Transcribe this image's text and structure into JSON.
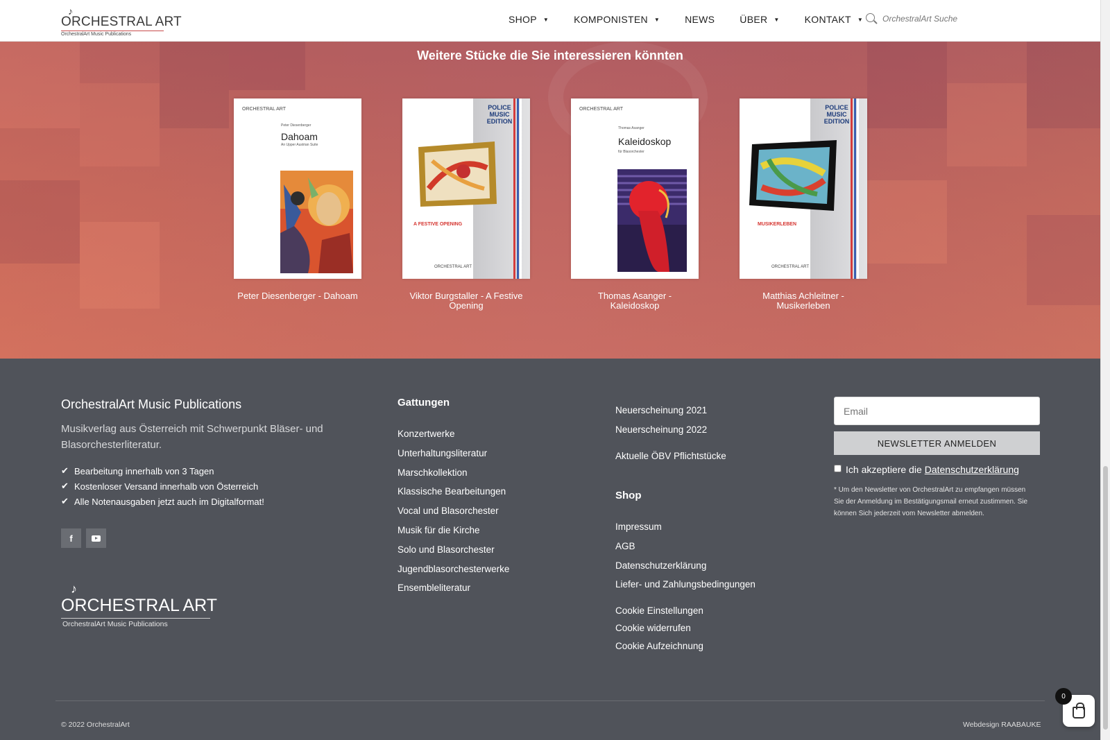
{
  "header": {
    "logo": {
      "name": "ORCHESTRAL ART",
      "sub": "OrchestralArt Music Publications"
    },
    "nav": [
      {
        "label": "SHOP",
        "caret": "▼"
      },
      {
        "label": "KOMPONISTEN",
        "caret": "▼"
      },
      {
        "label": "NEWS",
        "caret": ""
      },
      {
        "label": "ÜBER",
        "caret": "▼"
      },
      {
        "label": "KONTAKT",
        "caret": "▼"
      }
    ],
    "search": {
      "placeholder": "OrchestralArt Suche",
      "icon": "search-icon"
    }
  },
  "related": {
    "title": "Weitere Stücke die Sie interessieren könnten",
    "products": [
      {
        "title": "Peter Diesenberger - Dahoam",
        "cover": {
          "logo": "ORCHESTRAL ART",
          "composer": "Peter Diesenberger",
          "work": "Dahoam",
          "subtitle": "An Upper Austrian Suite",
          "edition": "",
          "work_lower": ""
        }
      },
      {
        "title": "Viktor Burgstaller - A Festive Opening",
        "cover": {
          "logo": "ORCHESTRAL ART",
          "composer": "",
          "work": "",
          "subtitle": "",
          "edition": "POLICE MUSIC EDITION",
          "work_lower": "A FESTIVE OPENING"
        }
      },
      {
        "title": "Thomas Asanger - Kaleidoskop",
        "cover": {
          "logo": "ORCHESTRAL ART",
          "composer": "Thomas Asanger",
          "work": "Kaleidoskop",
          "subtitle": "für Blasorchester",
          "edition": "",
          "work_lower": ""
        }
      },
      {
        "title": "Matthias Achleitner - Musikerleben",
        "cover": {
          "logo": "ORCHESTRAL ART",
          "composer": "",
          "work": "",
          "subtitle": "",
          "edition": "POLICE MUSIC EDITION",
          "work_lower": "MUSIKERLEBEN"
        }
      }
    ]
  },
  "footer": {
    "company": "OrchestralArt Music Publications",
    "description": "Musikverlag aus Österreich mit Schwerpunkt Bläser- und Blasorchesterliteratur.",
    "features": [
      "Bearbeitung innerhalb von 3 Tagen",
      "Kostenloser Versand innerhalb von Österreich",
      "Alle Notenausgaben jetzt auch im Digitalformat!"
    ],
    "socials": [
      {
        "name": "facebook-icon",
        "glyph": "f"
      },
      {
        "name": "youtube-icon",
        "glyph": ""
      }
    ],
    "logo": {
      "name": "ORCHESTRAL ART",
      "sub": "OrchestralArt Music Publications"
    },
    "genres": {
      "heading": "Gattungen",
      "items": [
        "Konzertwerke",
        "Unterhaltungsliteratur",
        "Marschkollektion",
        "Klassische Bearbeitungen",
        "Vocal und Blasorchester",
        "Musik für die Kirche",
        "Solo und Blasorchester",
        "Jugendblasorchesterwerke",
        "Ensembleliteratur"
      ]
    },
    "releases": [
      "Neuerscheinung 2021",
      "Neuerscheinung 2022"
    ],
    "obv": "Aktuelle ÖBV Pflichtstücke",
    "shop": {
      "heading": "Shop",
      "items": [
        "Impressum",
        "AGB",
        "Datenschutzerklärung",
        "Liefer- und Zahlungsbedingungen"
      ]
    },
    "cookies": [
      "Cookie Einstellungen",
      "Cookie widerrufen",
      "Cookie Aufzeichnung"
    ],
    "newsletter": {
      "email_placeholder": "Email",
      "button": "NEWSLETTER ANMELDEN",
      "consent_text": "Ich akzeptiere die",
      "consent_link": "Datenschutzerklärung",
      "note": "* Um den Newsletter von OrchestralArt zu empfangen müssen Sie der Anmeldung im Bestätigungsmail erneut zustimmen. Sie können Sich jederzeit vom Newsletter abmelden."
    },
    "copyright": "© 2022 OrchestralArt",
    "credit": "Webdesign RAABAUKE"
  },
  "cart": {
    "count": "0"
  },
  "colors": {
    "footer_bg": "#50535a",
    "hero_bg": "#c46c64",
    "accent_red": "#c74b4b"
  }
}
